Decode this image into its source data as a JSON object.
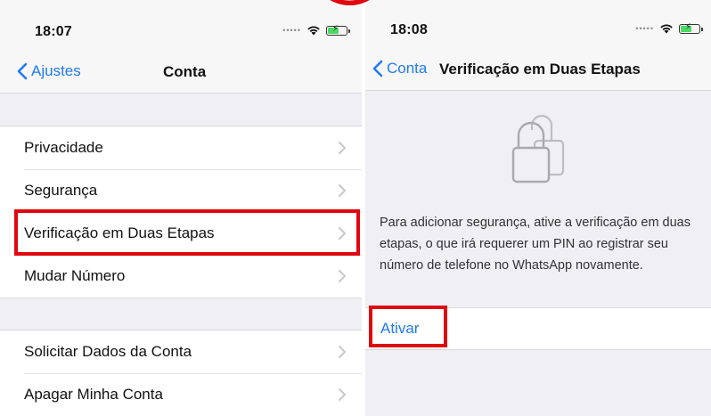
{
  "left_screen": {
    "status": {
      "time": "18:07"
    },
    "nav": {
      "back_label": "Ajustes",
      "title": "Conta"
    },
    "section1": [
      "Privacidade",
      "Segurança",
      "Verificação em Duas Etapas",
      "Mudar Número"
    ],
    "section2": [
      "Solicitar Dados da Conta",
      "Apagar Minha Conta"
    ],
    "highlighted_item": "Verificação em Duas Etapas"
  },
  "right_screen": {
    "status": {
      "time": "18:08"
    },
    "nav": {
      "back_label": "Conta",
      "title": "Verificação em Duas Etapas"
    },
    "lock_icon": "lock-icon",
    "description": "Para adicionar segurança, ative a verificação em duas etapas, o que irá requerer um PIN ao registrar seu número de telefone no WhatsApp novamente.",
    "action_label": "Ativar"
  },
  "colors": {
    "ios_blue": "#1f7bf0",
    "highlight_red": "#e0060f",
    "background_gray": "#efeff4",
    "battery_green": "#4cd964"
  }
}
